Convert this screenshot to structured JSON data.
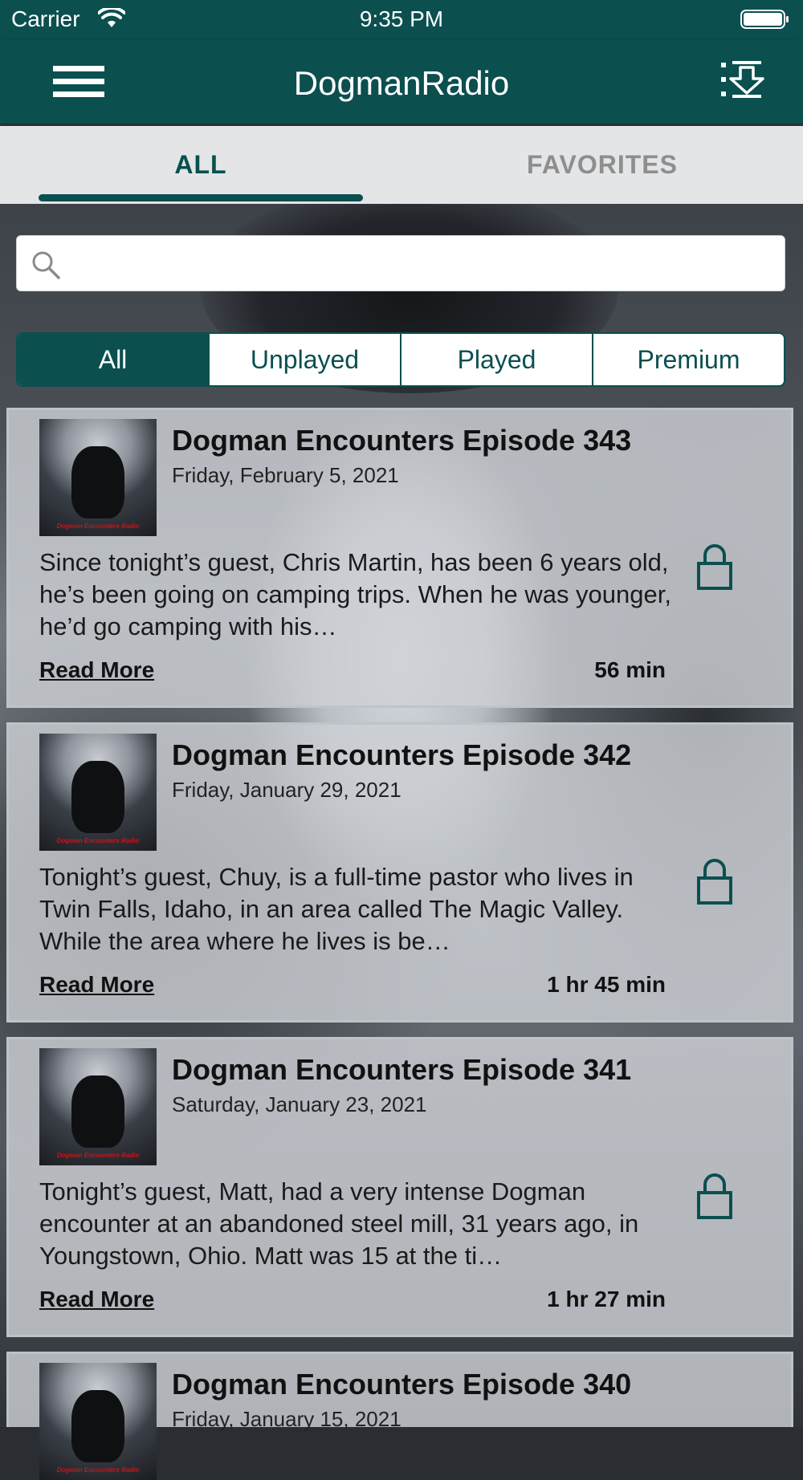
{
  "status_bar": {
    "carrier": "Carrier",
    "time": "9:35 PM"
  },
  "nav": {
    "title": "DogmanRadio",
    "menu_icon": "hamburger-menu-icon",
    "download_icon": "download-list-icon"
  },
  "tabs": [
    {
      "label": "ALL",
      "active": true
    },
    {
      "label": "FAVORITES",
      "active": false
    }
  ],
  "search": {
    "placeholder": "",
    "value": ""
  },
  "filters": [
    {
      "label": "All",
      "selected": true
    },
    {
      "label": "Unplayed",
      "selected": false
    },
    {
      "label": "Played",
      "selected": false
    },
    {
      "label": "Premium",
      "selected": false
    }
  ],
  "episodes": [
    {
      "title": "Dogman Encounters Episode 343",
      "date": "Friday, February 5, 2021",
      "description": "Since tonight’s guest, Chris Martin, has been 6 years old, he’s been going on camping trips. When he was younger, he’d go camping with his…",
      "read_more": "Read More",
      "duration": "56 min",
      "thumb_caption": "Dogman Encounters Radio"
    },
    {
      "title": "Dogman Encounters Episode 342",
      "date": "Friday, January 29, 2021",
      "description": "Tonight’s guest, Chuy, is a full-time pastor who lives in Twin Falls, Idaho, in an area called The Magic Valley. While the area where he lives is be…",
      "read_more": "Read More",
      "duration": "1 hr 45 min",
      "thumb_caption": "Dogman Encounters Radio"
    },
    {
      "title": "Dogman Encounters Episode 341",
      "date": "Saturday, January 23, 2021",
      "description": "Tonight’s guest, Matt, had a very intense Dogman encounter at an abandoned steel mill, 31 years ago, in Youngstown, Ohio. Matt was 15 at the ti…",
      "read_more": "Read More",
      "duration": "1 hr 27 min",
      "thumb_caption": "Dogman Encounters Radio"
    },
    {
      "title": "Dogman Encounters Episode 340",
      "date": "Friday, January 15, 2021",
      "description": "",
      "read_more": "",
      "duration": "",
      "thumb_caption": "Dogman Encounters Radio"
    }
  ],
  "colors": {
    "primary": "#0b4f4f",
    "tab_inactive": "#8e8e8e",
    "card_bg": "#cdd1d5"
  }
}
